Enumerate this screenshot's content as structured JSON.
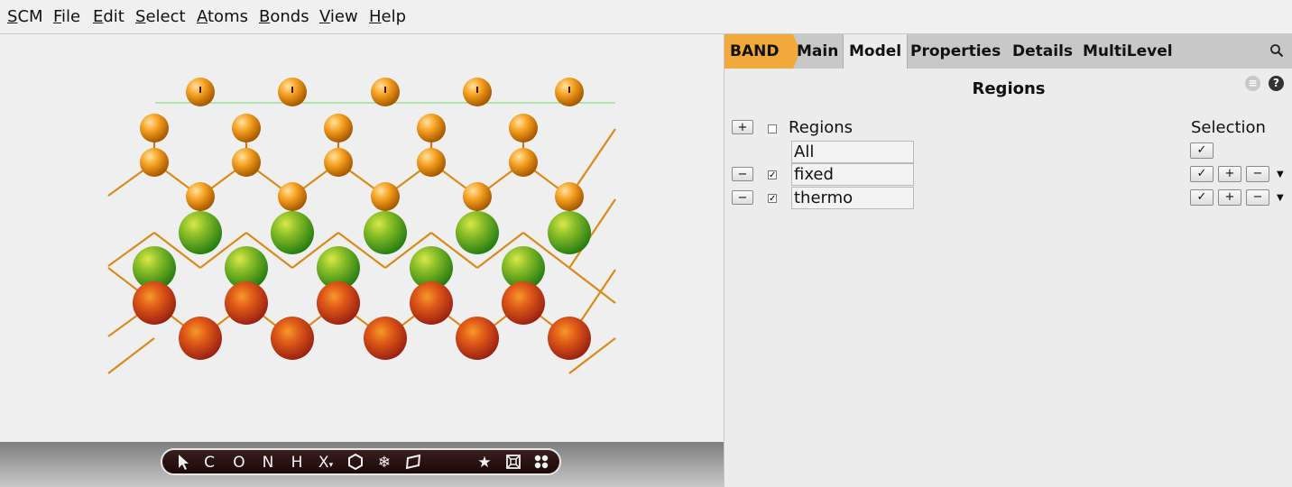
{
  "menubar": {
    "items": [
      {
        "underline": "S",
        "rest": "CM"
      },
      {
        "underline": "F",
        "rest": "ile"
      },
      {
        "underline": "E",
        "rest": "dit"
      },
      {
        "underline": "S",
        "rest": "elect"
      },
      {
        "underline": "A",
        "rest": "toms"
      },
      {
        "underline": "B",
        "rest": "onds"
      },
      {
        "underline": "V",
        "rest": "iew"
      },
      {
        "underline": "H",
        "rest": "elp"
      }
    ]
  },
  "tabs": {
    "band": "BAND",
    "main": "Main",
    "model": "Model",
    "properties": "Properties",
    "details": "Details",
    "multilevel": "MultiLevel"
  },
  "panel": {
    "title": "Regions",
    "regions_header": "Regions",
    "selection_header": "Selection",
    "add_symbol": "+",
    "remove_symbol": "−",
    "check_symbol": "✓",
    "rows": [
      {
        "name": "All"
      },
      {
        "name": "fixed"
      },
      {
        "name": "thermo"
      }
    ]
  },
  "toolbar": {
    "tools": [
      "C",
      "O",
      "N",
      "H",
      "X"
    ]
  },
  "colors": {
    "band_tab": "#f2a93b",
    "atom_orange": "#f5a020",
    "atom_green": "#4fb82a",
    "atom_red": "#c8261a",
    "bond": "#d98a1a"
  }
}
